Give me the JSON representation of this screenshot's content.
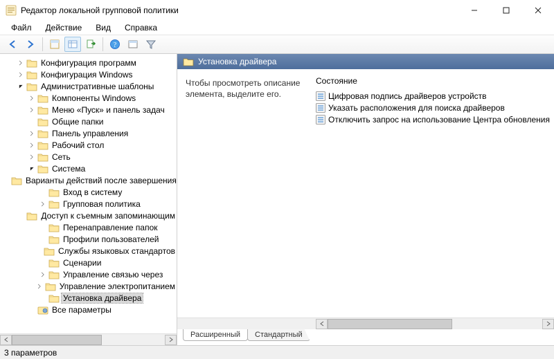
{
  "window": {
    "title": "Редактор локальной групповой политики"
  },
  "menu": {
    "file": "Файл",
    "action": "Действие",
    "view": "Вид",
    "help": "Справка"
  },
  "tree": {
    "nodes": [
      {
        "label": "Конфигурация программ",
        "depth": 2,
        "exp": "closed"
      },
      {
        "label": "Конфигурация Windows",
        "depth": 2,
        "exp": "closed"
      },
      {
        "label": "Административные шаблоны",
        "depth": 2,
        "exp": "open"
      },
      {
        "label": "Компоненты Windows",
        "depth": 3,
        "exp": "closed"
      },
      {
        "label": "Меню «Пуск» и панель задач",
        "depth": 3,
        "exp": "closed"
      },
      {
        "label": "Общие папки",
        "depth": 3,
        "exp": "none"
      },
      {
        "label": "Панель управления",
        "depth": 3,
        "exp": "closed"
      },
      {
        "label": "Рабочий стол",
        "depth": 3,
        "exp": "closed"
      },
      {
        "label": "Сеть",
        "depth": 3,
        "exp": "closed"
      },
      {
        "label": "Система",
        "depth": 3,
        "exp": "open"
      },
      {
        "label": "Варианты действий после завершения",
        "depth": 4,
        "exp": "none"
      },
      {
        "label": "Вход в систему",
        "depth": 4,
        "exp": "none"
      },
      {
        "label": "Групповая политика",
        "depth": 4,
        "exp": "closed"
      },
      {
        "label": "Доступ к съемным запоминающим",
        "depth": 4,
        "exp": "none"
      },
      {
        "label": "Перенаправление папок",
        "depth": 4,
        "exp": "none"
      },
      {
        "label": "Профили пользователей",
        "depth": 4,
        "exp": "none"
      },
      {
        "label": "Службы языковых стандартов",
        "depth": 4,
        "exp": "none"
      },
      {
        "label": "Сценарии",
        "depth": 4,
        "exp": "none"
      },
      {
        "label": "Управление связью через",
        "depth": 4,
        "exp": "closed"
      },
      {
        "label": "Управление электропитанием",
        "depth": 4,
        "exp": "closed"
      },
      {
        "label": "Установка драйвера",
        "depth": 4,
        "exp": "none",
        "selected": true
      },
      {
        "label": "Все параметры",
        "depth": 3,
        "exp": "none",
        "icon": "allp"
      }
    ]
  },
  "right": {
    "header": "Установка драйвера",
    "description": "Чтобы просмотреть описание элемента, выделите его.",
    "column": "Состояние",
    "items": [
      "Цифровая подпись драйверов устройств",
      "Указать расположения для поиска драйверов",
      "Отключить запрос на использование Центра обновления"
    ]
  },
  "tabs": {
    "extended": "Расширенный",
    "standard": "Стандартный"
  },
  "status": "3 параметров"
}
